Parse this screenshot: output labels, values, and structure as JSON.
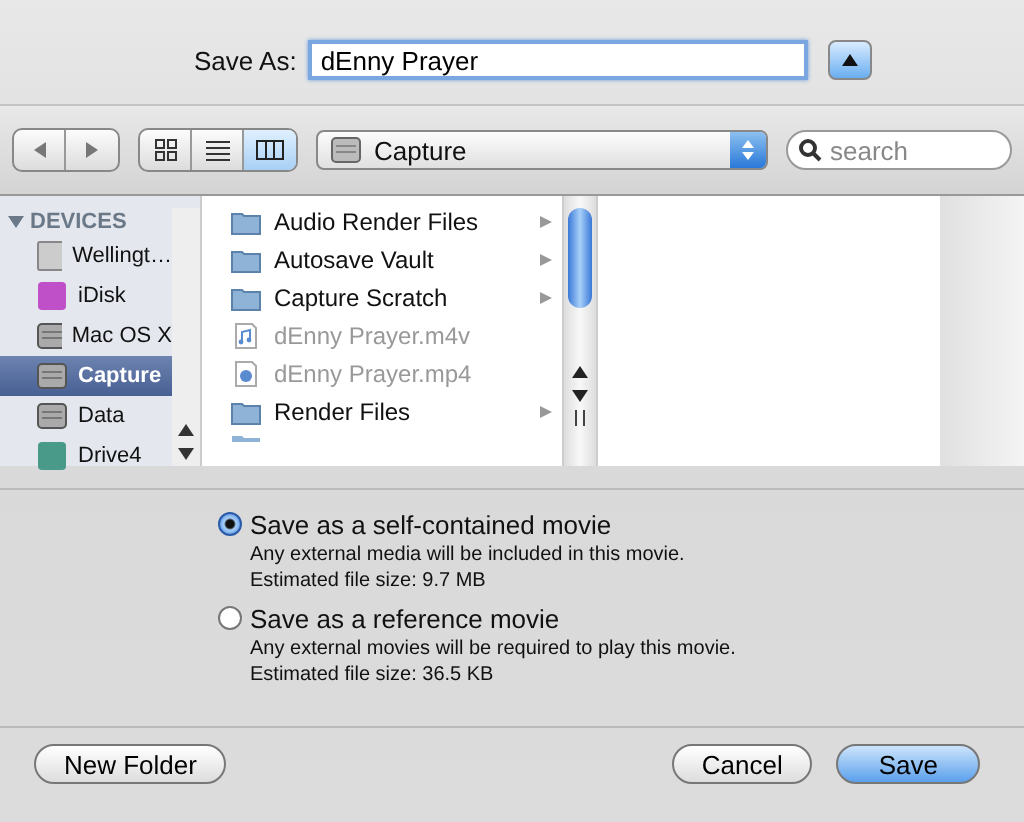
{
  "save_as": {
    "label": "Save As:",
    "value": "dEnny Prayer",
    "expanded": false
  },
  "view_modes": [
    {
      "kind": "icon",
      "selected": false
    },
    {
      "kind": "list",
      "selected": false
    },
    {
      "kind": "column",
      "selected": true
    }
  ],
  "location": {
    "value": "Capture"
  },
  "search": {
    "placeholder": "search"
  },
  "sidebar": {
    "heading": "DEVICES",
    "expanded": true,
    "items": [
      {
        "label": "Wellingt…",
        "kind": "computer",
        "selected": false
      },
      {
        "label": "iDisk",
        "kind": "idisk",
        "selected": false
      },
      {
        "label": "Mac OS X",
        "kind": "drive",
        "selected": false
      },
      {
        "label": "Capture",
        "kind": "drive",
        "selected": true
      },
      {
        "label": "Data",
        "kind": "drive",
        "selected": false
      },
      {
        "label": "Drive4",
        "kind": "timemachine",
        "selected": false
      }
    ]
  },
  "files": [
    {
      "name": "Audio Render Files",
      "kind": "folder",
      "disabled": false,
      "has_children": true
    },
    {
      "name": "Autosave Vault",
      "kind": "folder",
      "disabled": false,
      "has_children": true
    },
    {
      "name": "Capture Scratch",
      "kind": "folder",
      "disabled": false,
      "has_children": true
    },
    {
      "name": "dEnny Prayer.m4v",
      "kind": "audio",
      "disabled": true,
      "has_children": false
    },
    {
      "name": "dEnny Prayer.mp4",
      "kind": "video",
      "disabled": true,
      "has_children": false
    },
    {
      "name": "Render Files",
      "kind": "folder",
      "disabled": false,
      "has_children": true
    }
  ],
  "options": [
    {
      "label": "Save as a self-contained movie",
      "selected": true,
      "note": "Any external media will be included in this movie.",
      "size": "Estimated file size:  9.7 MB"
    },
    {
      "label": "Save as a reference movie",
      "selected": false,
      "note": "Any external movies will be required to play this movie.",
      "size": "Estimated file size:  36.5 KB"
    }
  ],
  "buttons": {
    "new_folder": "New Folder",
    "cancel": "Cancel",
    "save": "Save"
  }
}
